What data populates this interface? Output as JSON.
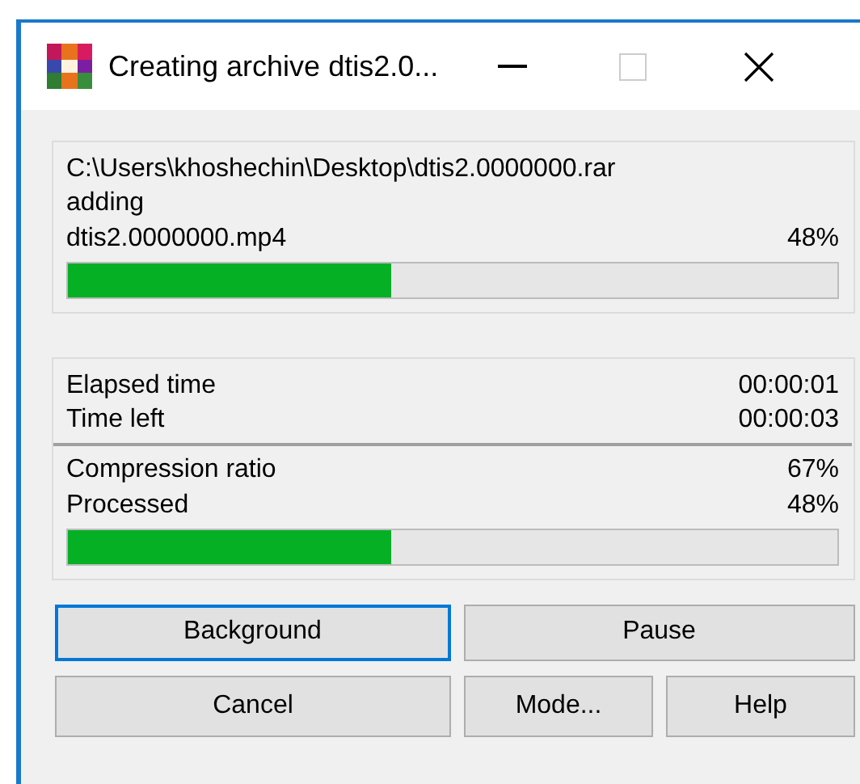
{
  "window": {
    "title": "Creating archive dtis2.0..."
  },
  "file_panel": {
    "archive_path": "C:\\Users\\khoshechin\\Desktop\\dtis2.0000000.rar",
    "action": "adding",
    "file_name": "dtis2.0000000.mp4",
    "percent": "48%",
    "level": 0.42
  },
  "stats_panel": {
    "times": [
      {
        "label": "Elapsed time",
        "value": "00:00:01"
      },
      {
        "label": "Time left",
        "value": "00:00:03"
      }
    ],
    "totals": [
      {
        "label": "Compression ratio",
        "value": "67%"
      },
      {
        "label": "Processed",
        "value": "48%"
      }
    ],
    "level": 0.42
  },
  "button_rows": [
    [
      {
        "label": "Background",
        "focused": true
      },
      {
        "label": "Pause",
        "focused": false
      }
    ],
    [
      {
        "label": "Cancel",
        "focused": false
      },
      {
        "label": "Mode...",
        "focused": false
      },
      {
        "label": "Help",
        "focused": false
      }
    ]
  ]
}
